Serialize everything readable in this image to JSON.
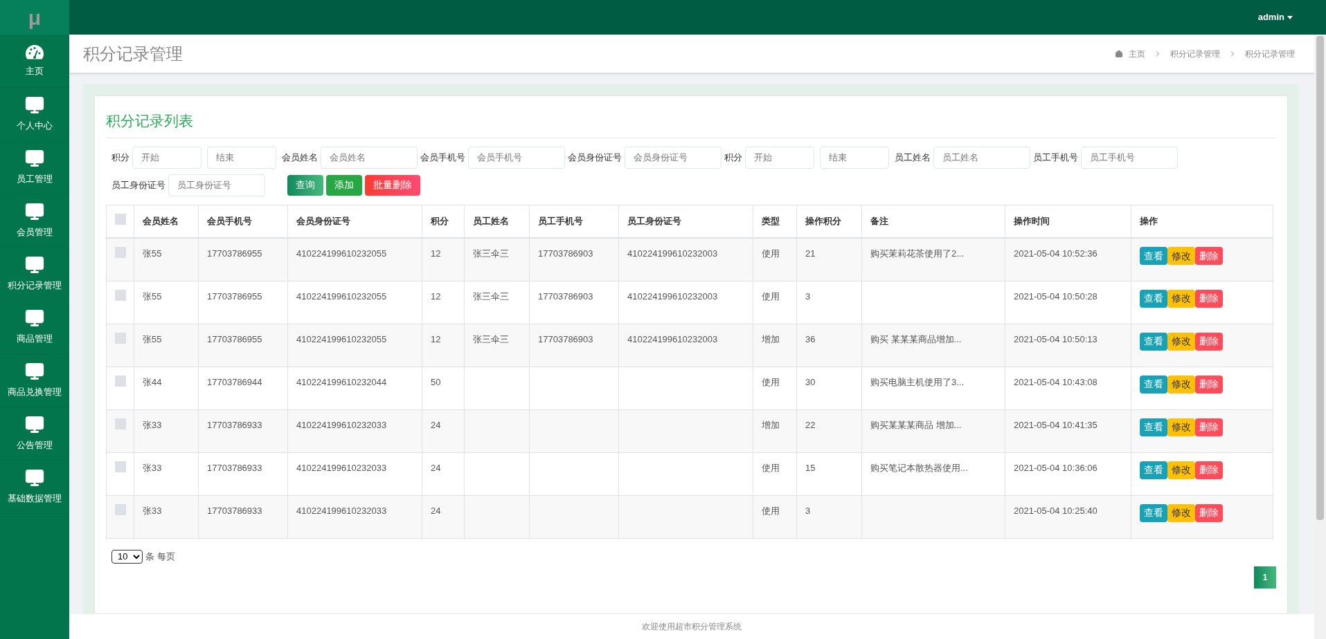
{
  "logo": "μ",
  "user": {
    "name": "admin"
  },
  "sidebar": {
    "items": [
      {
        "label": "主页",
        "kind": "home"
      },
      {
        "label": "个人中心",
        "kind": "module"
      },
      {
        "label": "员工管理",
        "kind": "module"
      },
      {
        "label": "会员管理",
        "kind": "module"
      },
      {
        "label": "积分记录管理",
        "kind": "module"
      },
      {
        "label": "商品管理",
        "kind": "module"
      },
      {
        "label": "商品兑换管理",
        "kind": "module"
      },
      {
        "label": "公告管理",
        "kind": "module"
      },
      {
        "label": "基础数据管理",
        "kind": "module"
      }
    ]
  },
  "page_title": "积分记录管理",
  "breadcrumb": [
    "主页",
    "积分记录管理",
    "积分记录管理"
  ],
  "card_title": "积分记录列表",
  "filters": [
    {
      "label": "积分",
      "placeholders": [
        "开始",
        "结束"
      ]
    },
    {
      "label": "会员姓名",
      "placeholders": [
        "会员姓名"
      ]
    },
    {
      "label": "会员手机号",
      "placeholders": [
        "会员手机号"
      ]
    },
    {
      "label": "会员身份证号",
      "placeholders": [
        "会员身份证号"
      ]
    },
    {
      "label": "积分",
      "placeholders": [
        "开始",
        "结束"
      ]
    },
    {
      "label": "员工姓名",
      "placeholders": [
        "员工姓名"
      ]
    },
    {
      "label": "员工手机号",
      "placeholders": [
        "员工手机号"
      ]
    },
    {
      "label": "员工身份证号",
      "placeholders": [
        "员工身份证号"
      ]
    }
  ],
  "filter_buttons": [
    {
      "label": "查询",
      "kind": "query"
    },
    {
      "label": "添加",
      "kind": "add"
    },
    {
      "label": "批量删除",
      "kind": "delete"
    }
  ],
  "table": {
    "select_all": {
      "checked": false
    },
    "columns": [
      "会员姓名",
      "会员手机号",
      "会员身份证号",
      "积分",
      "员工姓名",
      "员工手机号",
      "员工身份证号",
      "类型",
      "操作积分",
      "备注",
      "操作时间",
      "操作"
    ],
    "rows": [
      {
        "checked": false,
        "cells": [
          "张55",
          "17703786955",
          "410224199610232055",
          "12",
          "张三伞三",
          "17703786903",
          "410224199610232003",
          "使用",
          "21",
          "购买茉莉花茶使用了2...",
          "2021-05-04 10:52:36"
        ],
        "actions": [
          {
            "label": "查看",
            "kind": "view"
          },
          {
            "label": "修改",
            "kind": "edit"
          },
          {
            "label": "删除",
            "kind": "delete"
          }
        ]
      },
      {
        "checked": false,
        "cells": [
          "张55",
          "17703786955",
          "410224199610232055",
          "12",
          "张三伞三",
          "17703786903",
          "410224199610232003",
          "使用",
          "3",
          "",
          "2021-05-04 10:50:28"
        ],
        "actions": [
          {
            "label": "查看",
            "kind": "view"
          },
          {
            "label": "修改",
            "kind": "edit"
          },
          {
            "label": "删除",
            "kind": "delete"
          }
        ]
      },
      {
        "checked": false,
        "cells": [
          "张55",
          "17703786955",
          "410224199610232055",
          "12",
          "张三伞三",
          "17703786903",
          "410224199610232003",
          "增加",
          "36",
          "购买 某某某商品增加...",
          "2021-05-04 10:50:13"
        ],
        "actions": [
          {
            "label": "查看",
            "kind": "view"
          },
          {
            "label": "修改",
            "kind": "edit"
          },
          {
            "label": "删除",
            "kind": "delete"
          }
        ]
      },
      {
        "checked": false,
        "cells": [
          "张44",
          "17703786944",
          "410224199610232044",
          "50",
          "",
          "",
          "",
          "使用",
          "30",
          "购买电脑主机使用了3...",
          "2021-05-04 10:43:08"
        ],
        "actions": [
          {
            "label": "查看",
            "kind": "view"
          },
          {
            "label": "修改",
            "kind": "edit"
          },
          {
            "label": "删除",
            "kind": "delete"
          }
        ]
      },
      {
        "checked": false,
        "cells": [
          "张33",
          "17703786933",
          "410224199610232033",
          "24",
          "",
          "",
          "",
          "增加",
          "22",
          "购买某某某商品 增加...",
          "2021-05-04 10:41:35"
        ],
        "actions": [
          {
            "label": "查看",
            "kind": "view"
          },
          {
            "label": "修改",
            "kind": "edit"
          },
          {
            "label": "删除",
            "kind": "delete"
          }
        ]
      },
      {
        "checked": false,
        "cells": [
          "张33",
          "17703786933",
          "410224199610232033",
          "24",
          "",
          "",
          "",
          "使用",
          "15",
          "购买笔记本散热器使用...",
          "2021-05-04 10:36:06"
        ],
        "actions": [
          {
            "label": "查看",
            "kind": "view"
          },
          {
            "label": "修改",
            "kind": "edit"
          },
          {
            "label": "删除",
            "kind": "delete"
          }
        ]
      },
      {
        "checked": false,
        "cells": [
          "张33",
          "17703786933",
          "410224199610232033",
          "24",
          "",
          "",
          "",
          "使用",
          "3",
          "",
          "2021-05-04 10:25:40"
        ],
        "actions": [
          {
            "label": "查看",
            "kind": "view"
          },
          {
            "label": "修改",
            "kind": "edit"
          },
          {
            "label": "删除",
            "kind": "delete"
          }
        ]
      }
    ]
  },
  "pagination": {
    "page_size": "10",
    "page_size_label": "条 每页",
    "pages": [
      {
        "label": "1",
        "selected": true
      }
    ]
  },
  "footer": "欢迎使用超市积分管理系统"
}
